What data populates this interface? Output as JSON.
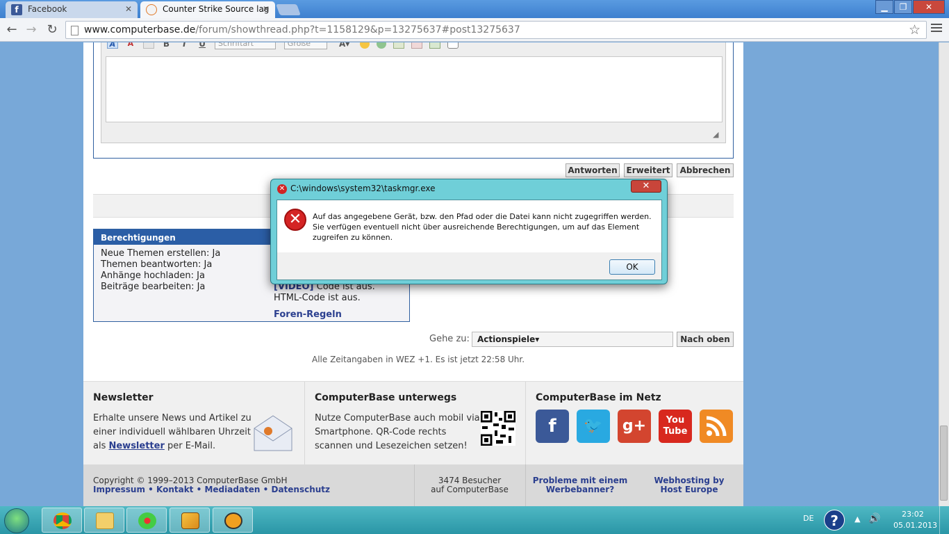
{
  "browser": {
    "tabs": [
      {
        "label": "Facebook",
        "icon": "facebook-icon"
      },
      {
        "label": "Counter Strike Source lag",
        "icon": "computerbase-icon"
      }
    ],
    "url_domain": "www.computerbase.de",
    "url_path": "/forum/showthread.php?t=1158129&p=13275637#post13275637"
  },
  "editor": {
    "font_placeholder": "Schriftart",
    "size_placeholder": "Größe"
  },
  "buttons": {
    "reply": "Antworten",
    "advanced": "Erweitert",
    "cancel": "Abbrechen"
  },
  "permissions": {
    "title": "Berechtigungen",
    "lines": [
      "Neue Themen erstellen: Ja",
      "Themen beantworten: Ja",
      "Anhänge hochladen: Ja",
      "Beiträge bearbeiten: Ja"
    ],
    "video_code": "[VIDEO]",
    "video_status": " Code ist aus.",
    "html_code": "HTML-Code ist aus.",
    "rules_link": "Foren-Regeln"
  },
  "goto": {
    "label": "Gehe zu:",
    "selected": "Actionspiele",
    "top_button": "Nach oben"
  },
  "timezone_note": "Alle Zeitangaben in WEZ +1. Es ist jetzt 22:58 Uhr.",
  "footer": {
    "newsletter_title": "Newsletter",
    "newsletter_text_1": "Erhalte unsere News und Artikel zu",
    "newsletter_text_2": "einer individuell wählbaren Uhrzeit",
    "newsletter_text_3a": "als ",
    "newsletter_link": "Newsletter",
    "newsletter_text_3b": " per E-Mail.",
    "mobile_title": "ComputerBase unterwegs",
    "mobile_text_1": "Nutze ComputerBase auch mobil via",
    "mobile_text_2": "Smartphone. QR-Code rechts",
    "mobile_text_3": "scannen und Lesezeichen setzen!",
    "net_title": "ComputerBase im Netz",
    "copyright": "Copyright © 1999–2013 ComputerBase GmbH",
    "links": [
      "Impressum",
      "Kontakt",
      "Mediadaten",
      "Datenschutz"
    ],
    "visitors_1": "3474 Besucher",
    "visitors_2": "auf ComputerBase",
    "banner_1": "Probleme mit einem",
    "banner_2": "Werbebanner?",
    "hosting_1": "Webhosting by",
    "hosting_2": "Host Europe"
  },
  "dialog": {
    "title": "C:\\windows\\system32\\taskmgr.exe",
    "message": "Auf das angegebene Gerät, bzw. den Pfad oder die Datei kann nicht zugegriffen werden. Sie verfügen eventuell nicht über ausreichende Berechtigungen, um auf das Element zugreifen zu können.",
    "ok": "OK"
  },
  "taskbar": {
    "language": "DE",
    "time": "23:02",
    "date": "05.01.2013",
    "help_glyph": "?"
  },
  "colors": {
    "dialog_frame": "#6fcfd8",
    "taskbar": "#2a96a6",
    "forum_blue": "#2b5ea6",
    "link": "#2b3f8f"
  }
}
